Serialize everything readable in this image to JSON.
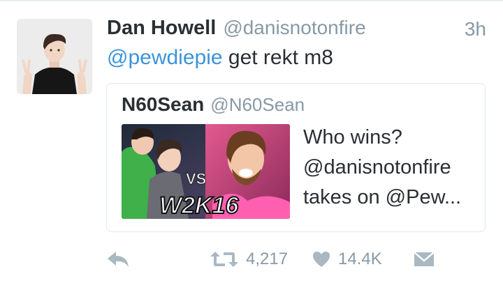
{
  "tweet": {
    "display_name": "Dan Howell",
    "handle": "@danisnotonfire",
    "timestamp": "3h",
    "text_mention": "@pewdiepie",
    "text_rest": " get rekt m8"
  },
  "quoted": {
    "display_name": "N60Sean",
    "handle": "@N60Sean",
    "text_lines": [
      "Who wins?",
      "@danisnotonfire",
      "takes on @Pew..."
    ],
    "media_badge": "VS",
    "media_logo": "W2K16"
  },
  "actions": {
    "reply_icon": "reply-icon",
    "retweet_icon": "retweet-icon",
    "retweet_count": "4,217",
    "like_icon": "heart-icon",
    "like_count": "14.4K",
    "dm_icon": "envelope-icon"
  },
  "colors": {
    "link": "#3b94d9",
    "text": "#292f33",
    "muted": "#8899a6",
    "icon": "#aab8c2",
    "border": "#e1e8ed"
  }
}
